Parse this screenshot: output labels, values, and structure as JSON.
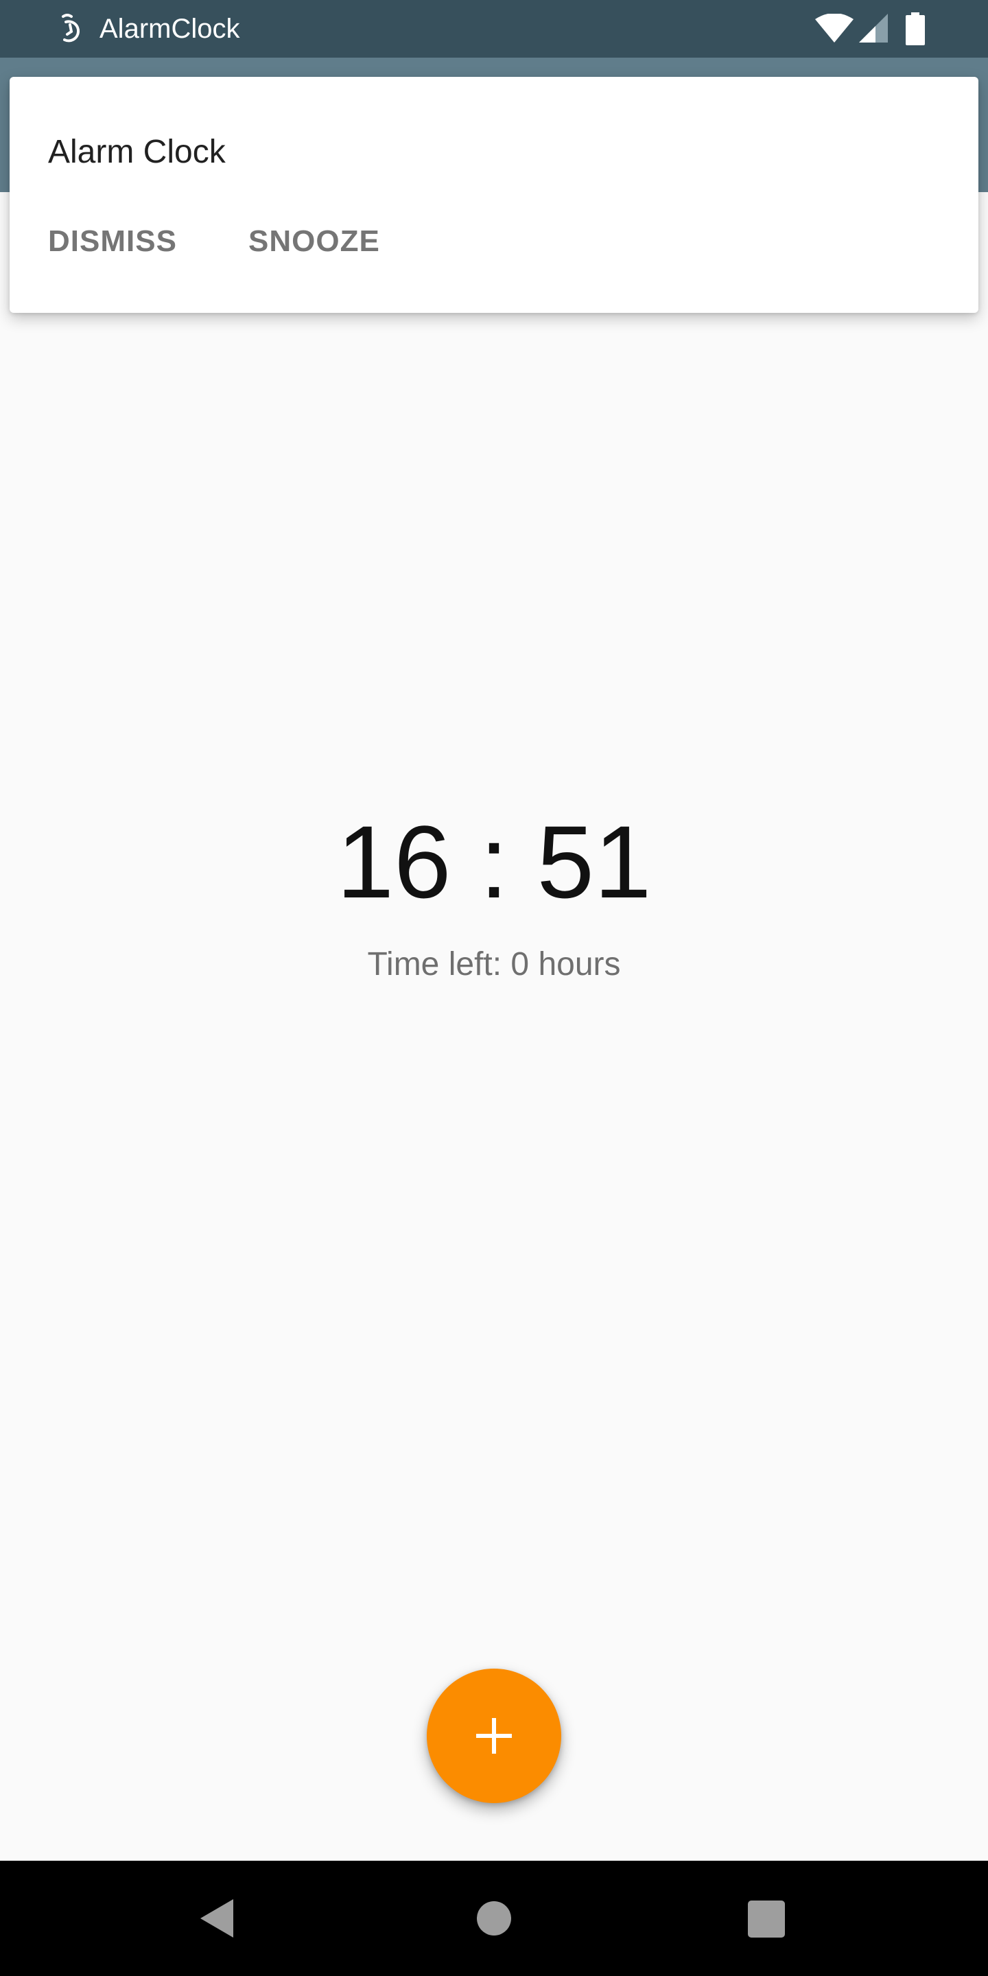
{
  "status_bar": {
    "app_name": "AlarmClock",
    "icons": [
      "alarm-icon",
      "wifi-icon",
      "cell-signal-icon",
      "battery-icon"
    ]
  },
  "notification": {
    "title": "Alarm Clock",
    "actions": {
      "dismiss": "DISMISS",
      "snooze": "SNOOZE"
    }
  },
  "main": {
    "alarm_time": "16 : 51",
    "time_left": "Time left: 0 hours"
  },
  "fab": {
    "icon": "plus-icon"
  },
  "nav_bar": {
    "icons": [
      "back-icon",
      "home-icon",
      "recents-icon"
    ]
  },
  "colors": {
    "status_bar": "#37505c",
    "toolbar": "#607d8b",
    "background": "#fafafa",
    "fab": "#fb8c00",
    "nav_bar": "#000000"
  }
}
